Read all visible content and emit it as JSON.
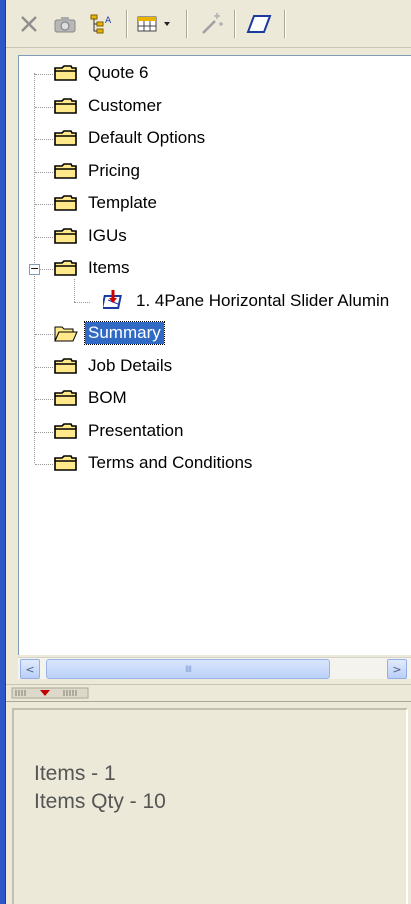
{
  "toolbar": {
    "buttons": [
      {
        "icon": "delete-icon"
      },
      {
        "icon": "camera-icon"
      },
      {
        "icon": "tree-text-icon"
      },
      {
        "icon": "layout-dropdown-icon"
      },
      {
        "icon": "wand-icon"
      },
      {
        "icon": "eraser-icon"
      }
    ]
  },
  "tree": {
    "nodes": [
      {
        "label": "Quote 6",
        "icon": "folder-closed-icon"
      },
      {
        "label": "Customer",
        "icon": "folder-closed-icon"
      },
      {
        "label": "Default Options",
        "icon": "folder-closed-icon"
      },
      {
        "label": "Pricing",
        "icon": "folder-closed-icon"
      },
      {
        "label": "Template",
        "icon": "folder-closed-icon"
      },
      {
        "label": "IGUs",
        "icon": "folder-closed-icon"
      },
      {
        "label": "Items",
        "icon": "folder-closed-icon",
        "expanded": true
      },
      {
        "label": "1. 4Pane Horizontal Slider Alumin",
        "icon": "window-item-icon",
        "child": true
      },
      {
        "label": "Summary",
        "icon": "folder-open-icon",
        "selected": true
      },
      {
        "label": "Job Details",
        "icon": "folder-closed-icon"
      },
      {
        "label": "BOM",
        "icon": "folder-closed-icon"
      },
      {
        "label": "Presentation",
        "icon": "folder-closed-icon"
      },
      {
        "label": "Terms and Conditions",
        "icon": "folder-closed-icon"
      }
    ],
    "expander_symbol": "−"
  },
  "scrollbar": {
    "left_arrow": "<",
    "right_arrow": ">",
    "grip": "IIII"
  },
  "info": {
    "line1": "Items - 1",
    "line2": "Items Qty - 10"
  },
  "colors": {
    "selection": "#316ac5",
    "folder_fill": "#ffe98a",
    "folder_stroke": "#000000"
  }
}
